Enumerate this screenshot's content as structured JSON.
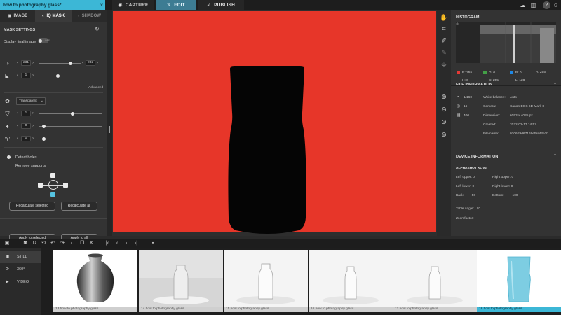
{
  "project": {
    "title": "how to photography glass*"
  },
  "main_tabs": [
    {
      "label": "CAPTURE",
      "icon": "camera-icon"
    },
    {
      "label": "EDIT",
      "icon": "edit-icon"
    },
    {
      "label": "PUBLISH",
      "icon": "rocket-icon"
    }
  ],
  "sub_tabs": [
    {
      "label": "IMAGE",
      "icon": "image-icon"
    },
    {
      "label": "IQ MASK",
      "icon": "mask-icon"
    },
    {
      "label": "SHADOW",
      "icon": "shadow-icon"
    }
  ],
  "mask": {
    "section_title": "MASK SETTINGS",
    "display_final_label": "Display final image",
    "toggle_text": "OFF",
    "threshold_low": "231",
    "threshold_high": "232",
    "smoothing": "1",
    "advanced": "Advanced",
    "background_option": "Transparent",
    "value_a": "1",
    "value_b": "0",
    "value_c": "0",
    "detect_holes": "Detect holes",
    "remove_supports": "Remove supports",
    "recalc_selected": "Recalculate selected",
    "recalc_all": "Recalculate all",
    "apply_selected": "Apply to selected",
    "apply_all": "Apply to all"
  },
  "histogram": {
    "title": "HISTOGRAM",
    "r": "R:  255",
    "g": "G:  0",
    "b": "B:  0",
    "a": "A:  255",
    "h": "H:  0",
    "s": "S:  255",
    "l": "L:  128",
    "colors": {
      "r": "#e53935",
      "g": "#43a047",
      "b": "#1e88e5"
    }
  },
  "file_info": {
    "title": "FILE INFORMATION",
    "shutter": "1/160",
    "aperture": "16",
    "iso": "400",
    "rows": [
      {
        "key": "White balance:",
        "value": "Auto"
      },
      {
        "key": "Camera:",
        "value": "Canon EOS 6D Mark II"
      },
      {
        "key": "Dimension:",
        "value": "6053 x 4035 px"
      },
      {
        "key": "Created:",
        "value": "2022-02-17 14:57"
      },
      {
        "key": "File name:",
        "value": "0306-f9d67169ef9a43e2b..."
      }
    ]
  },
  "device_info": {
    "title": "DEVICE INFORMATION",
    "device_name": "ALPHASHOT XL v2",
    "left_upper": "Left upper:  0",
    "right_upper": "Right upper:  0",
    "left_lower": "Left lower:  0",
    "right_lower": "Right lower:  0",
    "back": "Back:        50",
    "bottom": "Bottom:         100",
    "table_angle": "Table angle:   0°",
    "zoomfactor": "Zoomfactor:   -"
  },
  "categories": [
    {
      "label": "STILL",
      "icon": "camera-icon"
    },
    {
      "label": "360°",
      "icon": "rotate-icon"
    },
    {
      "label": "VIDEO",
      "icon": "play-icon"
    }
  ],
  "thumbnails": [
    {
      "caption": "13 how to photography glass"
    },
    {
      "caption": "14 how to photography glass"
    },
    {
      "caption": "15 how to photography glass"
    },
    {
      "caption": "16 how to photography glass"
    },
    {
      "caption": "17 how to photography glass"
    },
    {
      "caption": "18 how to photography glass"
    }
  ],
  "colors": {
    "accent": "#3cb7d6",
    "background_red": "#e73629",
    "panel": "#333333"
  }
}
